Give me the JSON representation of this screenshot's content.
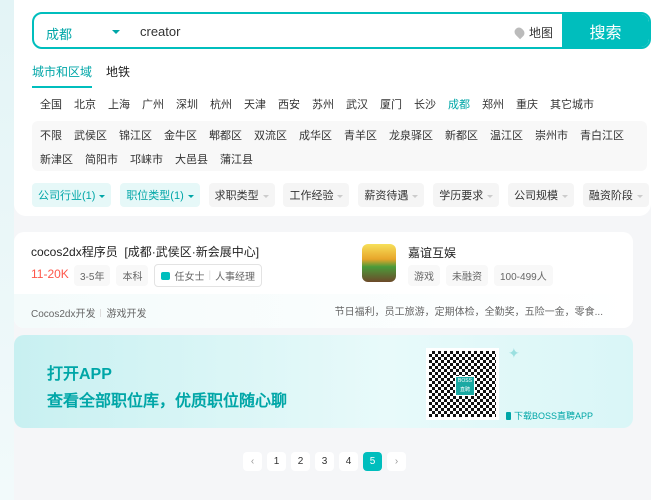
{
  "search": {
    "city": "成都",
    "query": "creator",
    "map_label": "地图",
    "button": "搜索"
  },
  "tabs": [
    "城市和区域",
    "地铁"
  ],
  "cities": [
    "全国",
    "北京",
    "上海",
    "广州",
    "深圳",
    "杭州",
    "天津",
    "西安",
    "苏州",
    "武汉",
    "厦门",
    "长沙",
    "成都",
    "郑州",
    "重庆",
    "其它城市"
  ],
  "districts": [
    "不限",
    "武侯区",
    "锦江区",
    "金牛区",
    "郫都区",
    "双流区",
    "成华区",
    "青羊区",
    "龙泉驿区",
    "新都区",
    "温江区",
    "崇州市",
    "青白江区",
    "新津区",
    "简阳市",
    "邛崃市",
    "大邑县",
    "蒲江县"
  ],
  "filters": [
    "公司行业(1)",
    "职位类型(1)",
    "求职类型",
    "工作经验",
    "薪资待遇",
    "学历要求",
    "公司规模",
    "融资阶段"
  ],
  "job": {
    "title": "cocos2dx程序员",
    "location": "[成都·武侯区·新会展中心]",
    "salary": "11-20K",
    "experience": "3-5年",
    "degree": "本科",
    "recruiter": "任女士",
    "recruiter_role": "人事经理",
    "company": "嘉谊互娱",
    "company_tags": [
      "游戏",
      "未融资",
      "100-499人"
    ],
    "skills": [
      "Cocos2dx开发",
      "游戏开发"
    ],
    "welfare": "节日福利，员工旅游，定期体检，全勤奖，五险一金，零食..."
  },
  "banner": {
    "line1": "打开APP",
    "line2": "查看全部职位库，优质职位随心聊",
    "qr_label": "BOSS直聘",
    "download": "下载BOSS直聘APP"
  },
  "pagination": {
    "pages": [
      "1",
      "2",
      "3",
      "4",
      "5"
    ],
    "current": "5",
    "prev": "‹",
    "next": "›"
  }
}
